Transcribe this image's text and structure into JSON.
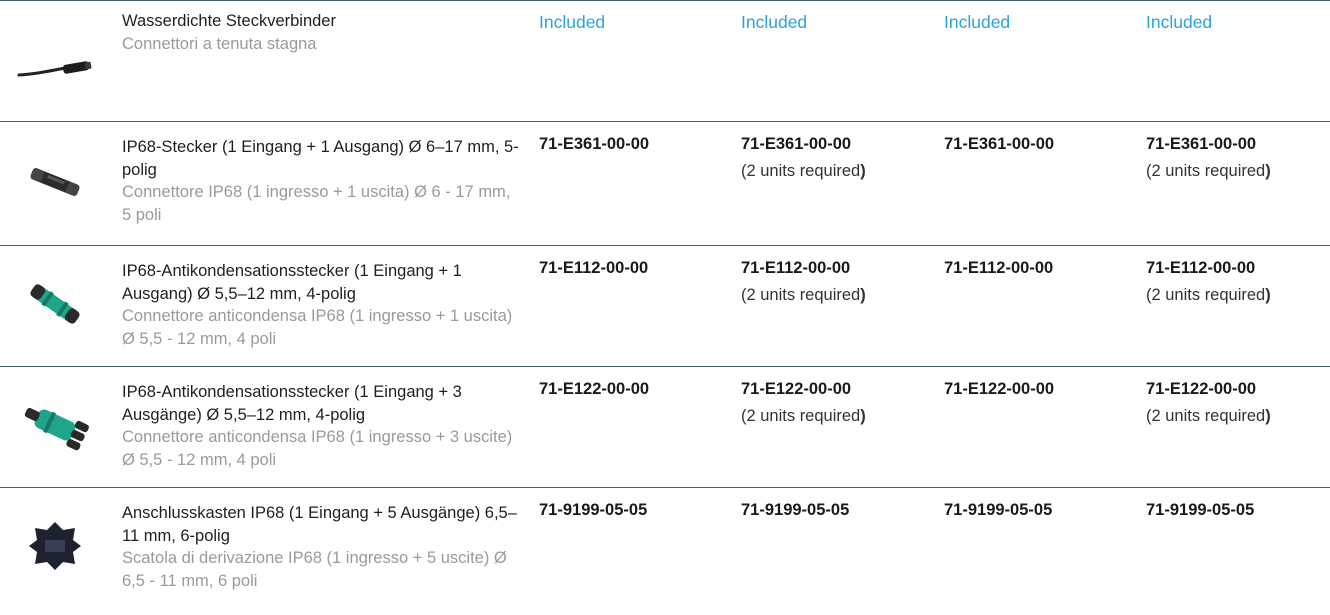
{
  "rows": [
    {
      "de": "Wasserdichte Steckverbinder",
      "it": "Connettori a tenuta stagna",
      "cols": [
        "Included",
        "Included",
        "Included",
        "Included"
      ],
      "icon": "waterproof-cable-icon"
    },
    {
      "de": "IP68-Stecker (1 Eingang + 1 Ausgang) Ø 6–17 mm, 5-polig",
      "it": "Connettore IP68 (1 ingresso + 1 uscita) Ø 6 - 17 mm, 5 poli",
      "codes": [
        "71-E361-00-00",
        "71-E361-00-00",
        "71-E361-00-00",
        "71-E361-00-00"
      ],
      "notes": [
        "",
        "(2 units required",
        "",
        "(2 units required"
      ],
      "icon": "ip68-connector-icon"
    },
    {
      "de": "IP68-Antikondensationsstecker (1 Eingang + 1 Ausgang) Ø 5,5–12 mm, 4-polig",
      "it": "Connettore anticondensa IP68 (1 ingresso + 1 uscita) Ø 5,5 - 12 mm, 4 poli",
      "codes": [
        "71-E112-00-00",
        "71-E112-00-00",
        "71-E112-00-00",
        "71-E112-00-00"
      ],
      "notes": [
        "",
        "(2 units required",
        "",
        "(2 units required"
      ],
      "icon": "anticondensation-connector-icon"
    },
    {
      "de": "IP68-Antikondensationsstecker (1 Eingang + 3 Ausgänge) Ø 5,5–12 mm, 4-polig",
      "it": "Connettore anticondensa IP68 (1 ingresso + 3 uscite) Ø 5,5 - 12 mm, 4 poli",
      "codes": [
        "71-E122-00-00",
        "71-E122-00-00",
        "71-E122-00-00",
        "71-E122-00-00"
      ],
      "notes": [
        "",
        "(2 units required",
        "",
        "(2 units required"
      ],
      "icon": "multi-output-connector-icon"
    },
    {
      "de": "Anschlusskasten IP68 (1 Eingang + 5 Ausgänge) 6,5–11 mm, 6-polig",
      "it": "Scatola di derivazione IP68 (1 ingresso + 5 uscite) Ø 6,5 - 11 mm, 6 poli",
      "codes": [
        "71-9199-05-05",
        "71-9199-05-05",
        "71-9199-05-05",
        "71-9199-05-05"
      ],
      "icon": "junction-box-icon"
    }
  ],
  "note_suffix": ")",
  "colors": {
    "included": "#2aa4d6",
    "rule": "#4a5a78",
    "italian": "#9a9a9a",
    "connector_green": "#1fa58a"
  }
}
